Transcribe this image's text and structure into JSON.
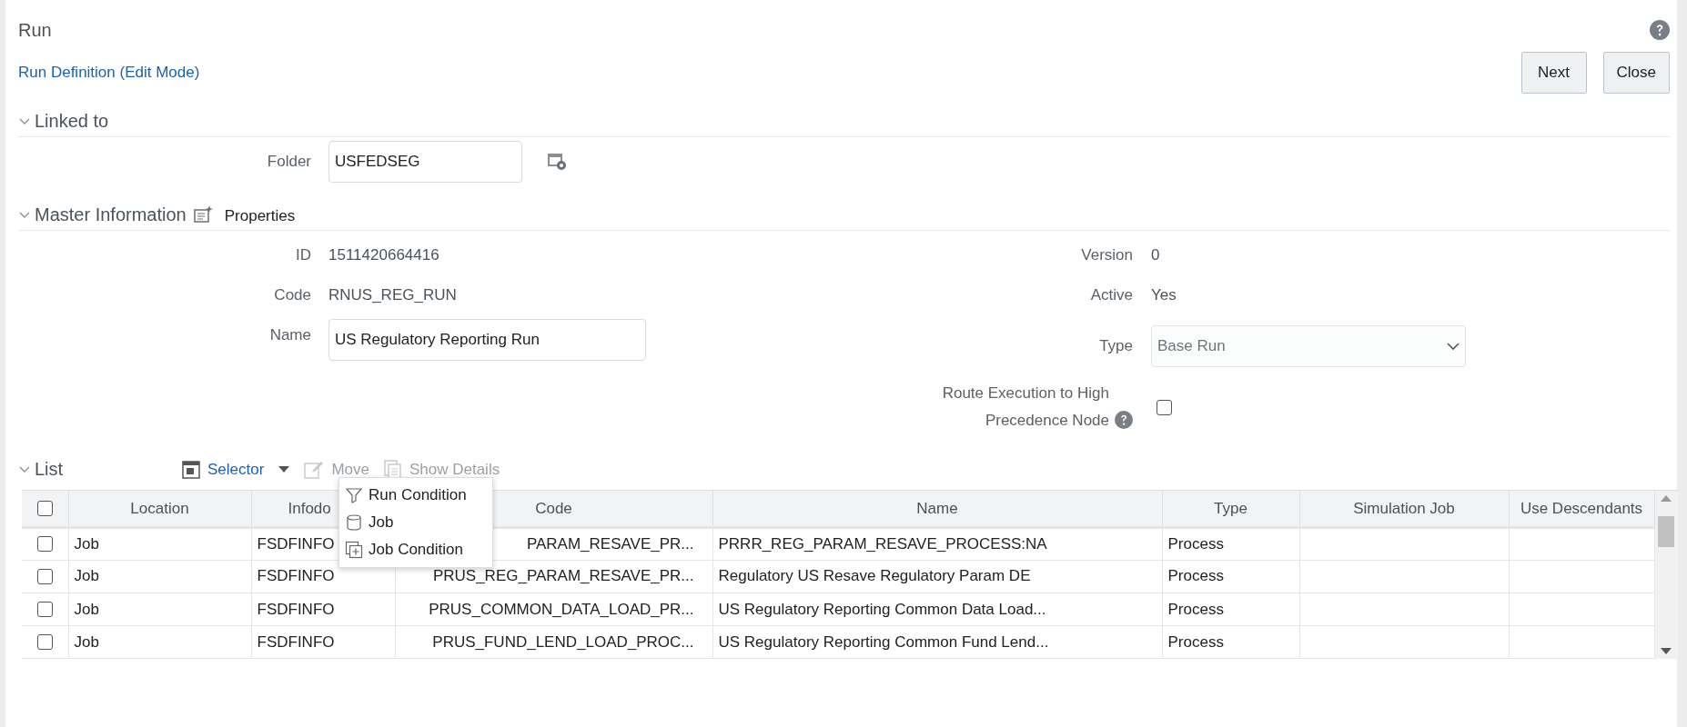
{
  "page": {
    "title": "Run",
    "breadcrumb": "Run Definition (Edit Mode)",
    "buttons": [
      "Next",
      "Close"
    ]
  },
  "linked_to": {
    "title": "Linked to",
    "expanded": true,
    "folder": {
      "label": "Folder",
      "value": "USFEDSEG"
    }
  },
  "master": {
    "title": "Master Information",
    "expanded": true,
    "properties": "Properties",
    "left": [
      {
        "kind": "text",
        "label": "ID",
        "value": "1511420664416"
      },
      {
        "kind": "text",
        "label": "Code",
        "value": "RNUS_REG_RUN"
      },
      {
        "kind": "input",
        "label": "Name",
        "value": "US Regulatory Reporting Run"
      }
    ],
    "right": [
      {
        "kind": "text",
        "label": "Version",
        "value": "0"
      },
      {
        "kind": "text",
        "label": "Active",
        "value": "Yes"
      },
      {
        "kind": "select",
        "label": "Type",
        "value": "Base Run",
        "disabled": true
      },
      {
        "kind": "checkbox",
        "label": "Route Execution to High Precedence Node",
        "checked": false
      }
    ]
  },
  "list": {
    "title": "List",
    "expanded": true,
    "toolbar": [
      {
        "kind": "selector",
        "label": "Selector",
        "disabled": false
      },
      {
        "kind": "move",
        "label": "Move",
        "disabled": true
      },
      {
        "kind": "details",
        "label": "Show Details",
        "disabled": true
      }
    ],
    "menu": {
      "open": true,
      "items": [
        {
          "kind": "filter",
          "label": "Run Condition"
        },
        {
          "kind": "job",
          "label": "Job"
        },
        {
          "kind": "condition",
          "label": "Job Condition"
        }
      ]
    },
    "header_checked": false,
    "columns": [
      "Location",
      "Infodo",
      "Code",
      "Name",
      "Type",
      "Simulation Job",
      "Use Descendants"
    ],
    "rows": [
      {
        "checked": false,
        "cells": [
          "Job",
          "FSDFINFO",
          "PARAM_RESAVE_PR...",
          "PRRR_REG_PARAM_RESAVE_PROCESS:NA",
          "Process",
          "",
          ""
        ]
      },
      {
        "checked": false,
        "cells": [
          "Job",
          "FSDFINFO",
          "PRUS_REG_PARAM_RESAVE_PR...",
          "Regulatory US Resave Regulatory Param DE",
          "Process",
          "",
          ""
        ]
      },
      {
        "checked": false,
        "cells": [
          "Job",
          "FSDFINFO",
          "PRUS_COMMON_DATA_LOAD_PR...",
          "US Regulatory Reporting Common Data Load...",
          "Process",
          "",
          ""
        ]
      },
      {
        "checked": false,
        "cells": [
          "Job",
          "FSDFINFO",
          "PRUS_FUND_LEND_LOAD_PROC...",
          "US Regulatory Reporting Common Fund Lend...",
          "Process",
          "",
          ""
        ]
      }
    ]
  }
}
